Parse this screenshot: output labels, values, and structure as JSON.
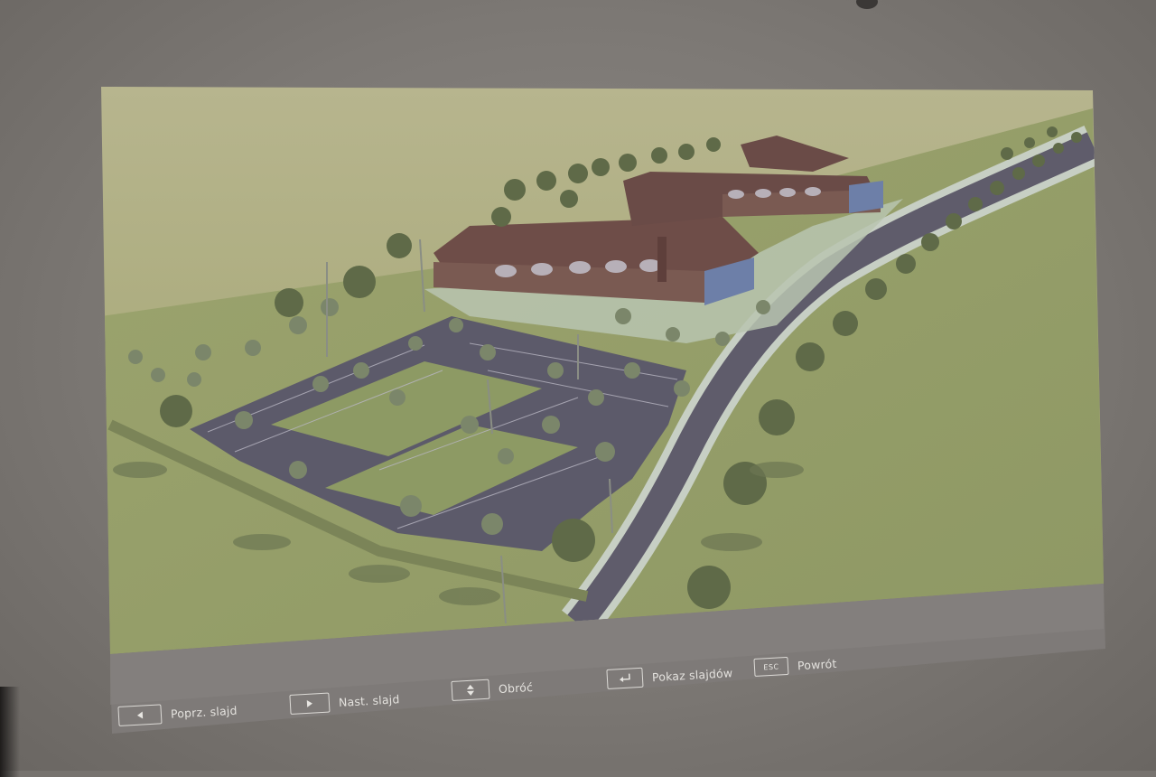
{
  "projection": {
    "scene": "3D aerial render of building complex with parking lot"
  },
  "controls": {
    "prev": {
      "label": "Poprz. slajd",
      "icon": "arrow-left-icon"
    },
    "next": {
      "label": "Nast. slajd",
      "icon": "arrow-right-icon"
    },
    "rotate": {
      "label": "Obróć",
      "icon": "up-down-icon"
    },
    "slideshow": {
      "label": "Pokaz slajdów",
      "icon": "enter-icon"
    },
    "back": {
      "label": "Powrót",
      "key": "ESC"
    }
  },
  "colors": {
    "wall": "#7c7874",
    "sky": "#b6b68a",
    "grass": "#97a06a",
    "asphalt": "#5e5a6a",
    "roof": "#6e4c48",
    "bar": "#7a7674"
  }
}
